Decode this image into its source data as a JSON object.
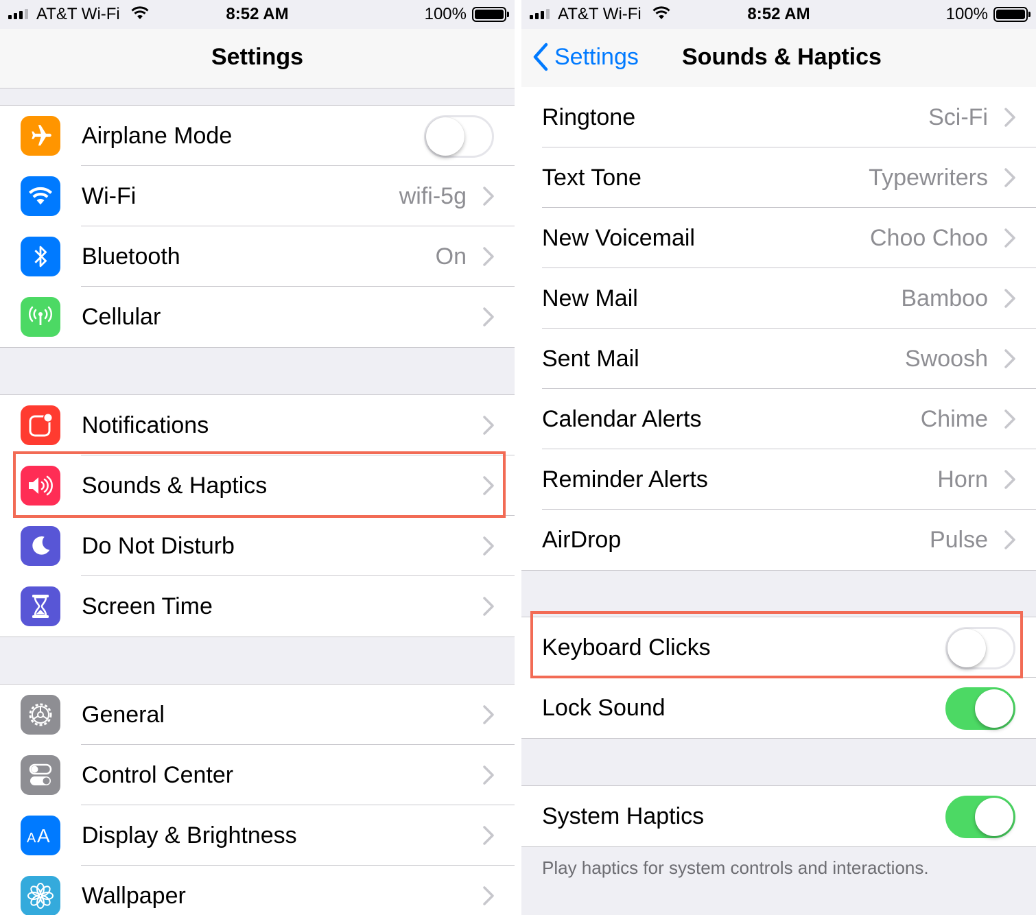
{
  "status_bar": {
    "carrier": "AT&T Wi-Fi",
    "time": "8:52 AM",
    "battery": "100%"
  },
  "left": {
    "title": "Settings",
    "groups": [
      [
        {
          "label": "Airplane Mode",
          "icon": "airplane-icon",
          "color": "#ff9500",
          "toggle": false
        },
        {
          "label": "Wi-Fi",
          "value": "wifi-5g",
          "icon": "wifi-icon",
          "color": "#007aff"
        },
        {
          "label": "Bluetooth",
          "value": "On",
          "icon": "bluetooth-icon",
          "color": "#007aff"
        },
        {
          "label": "Cellular",
          "icon": "antenna-icon",
          "color": "#4cd964"
        }
      ],
      [
        {
          "label": "Notifications",
          "icon": "notifications-icon",
          "color": "#ff3b30"
        },
        {
          "label": "Sounds & Haptics",
          "icon": "speaker-icon",
          "color": "#ff2d55"
        },
        {
          "label": "Do Not Disturb",
          "icon": "moon-icon",
          "color": "#5856d6"
        },
        {
          "label": "Screen Time",
          "icon": "hourglass-icon",
          "color": "#5856d6"
        }
      ],
      [
        {
          "label": "General",
          "icon": "gear-icon",
          "color": "#8e8e93"
        },
        {
          "label": "Control Center",
          "icon": "switches-icon",
          "color": "#8e8e93"
        },
        {
          "label": "Display & Brightness",
          "icon": "text-size-icon",
          "color": "#007aff"
        },
        {
          "label": "Wallpaper",
          "icon": "flower-icon",
          "color": "#34aadc"
        }
      ]
    ]
  },
  "right": {
    "back_label": "Settings",
    "title": "Sounds & Haptics",
    "sounds": [
      {
        "label": "Ringtone",
        "value": "Sci-Fi"
      },
      {
        "label": "Text Tone",
        "value": "Typewriters"
      },
      {
        "label": "New Voicemail",
        "value": "Choo Choo"
      },
      {
        "label": "New Mail",
        "value": "Bamboo"
      },
      {
        "label": "Sent Mail",
        "value": "Swoosh"
      },
      {
        "label": "Calendar Alerts",
        "value": "Chime"
      },
      {
        "label": "Reminder Alerts",
        "value": "Horn"
      },
      {
        "label": "AirDrop",
        "value": "Pulse"
      }
    ],
    "keyboard_clicks": {
      "label": "Keyboard Clicks",
      "on": false
    },
    "lock_sound": {
      "label": "Lock Sound",
      "on": true
    },
    "system_haptics": {
      "label": "System Haptics",
      "on": true
    },
    "footer": "Play haptics for system controls and interactions."
  },
  "colors": {
    "accent": "#007aff",
    "toggle_on": "#4cd964",
    "highlight": "#f26b55"
  }
}
